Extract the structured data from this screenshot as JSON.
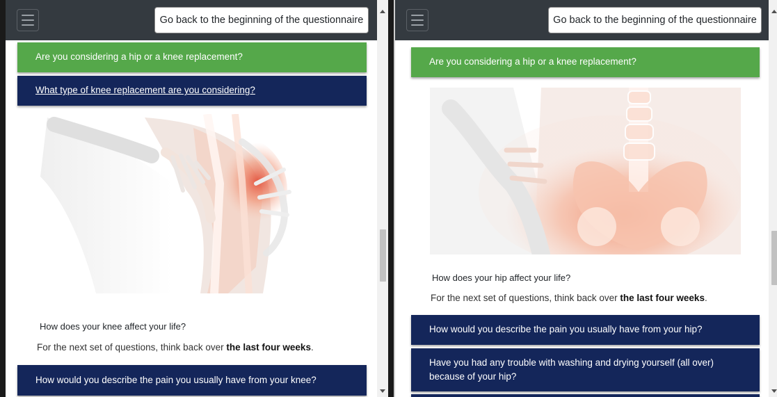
{
  "left": {
    "navbar": {
      "back_button": "Go back to the beginning of the questionnaire"
    },
    "question_main": "Are you considering a hip or a knee replacement?",
    "question_link": "What type of knee replacement are you considering?",
    "image": {
      "subject": "knee-xray-illustration"
    },
    "section_title": "How does your knee affect your life?",
    "instruction_prefix": "For the next set of questions, think back over ",
    "instruction_bold": "the last four weeks",
    "instruction_suffix": ".",
    "question_next": "How would you describe the pain you usually have from your knee?"
  },
  "right": {
    "navbar": {
      "back_button": "Go back to the beginning of the questionnaire"
    },
    "question_main": "Are you considering a hip or a knee replacement?",
    "image": {
      "subject": "hip-pelvis-xray-illustration"
    },
    "section_title": "How does your hip affect your life?",
    "instruction_prefix": "For the next set of questions, think back over ",
    "instruction_bold": "the last four weeks",
    "instruction_suffix": ".",
    "question_pain": "How would you describe the pain you usually have from your hip?",
    "question_washing": "Have you had any trouble with washing and drying yourself (all over) because of your hip?"
  },
  "colors": {
    "navbar": "#343a40",
    "answered_green": "#55a84a",
    "question_navy": "#14265a"
  }
}
